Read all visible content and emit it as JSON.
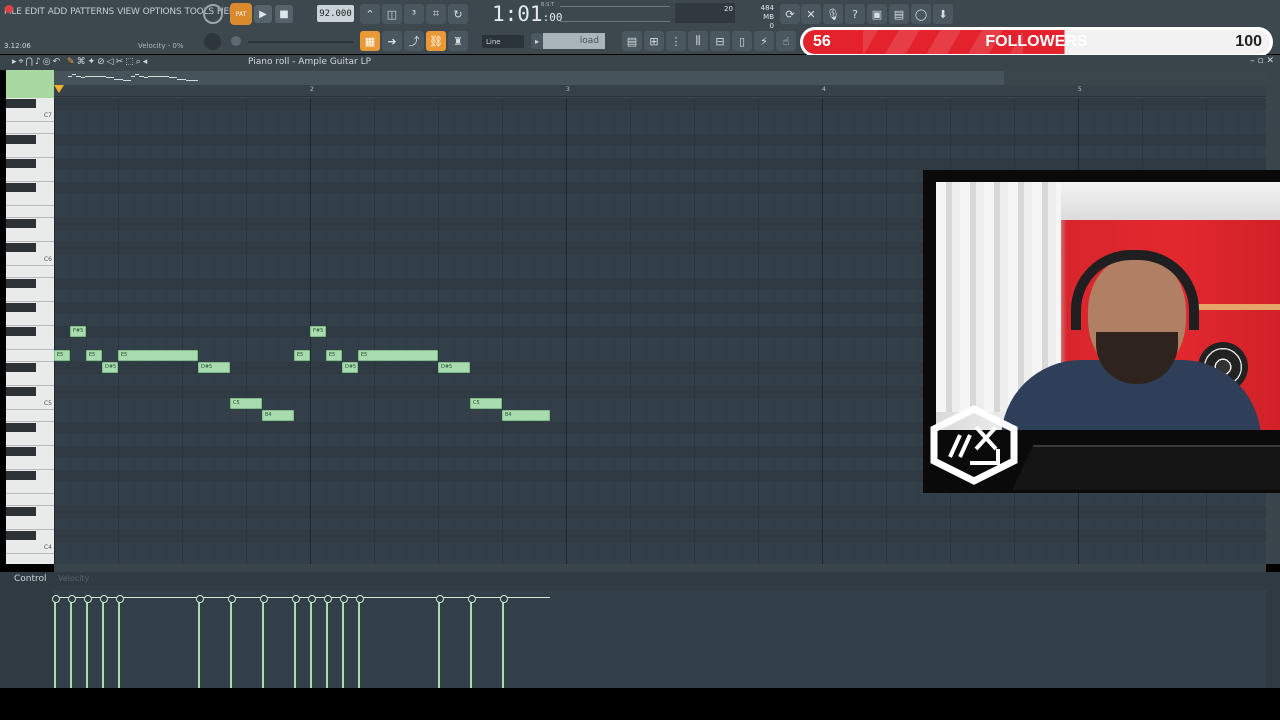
{
  "menu": [
    "FILE",
    "EDIT",
    "ADD",
    "PATTERNS",
    "VIEW",
    "OPTIONS",
    "TOOLS",
    "HELP"
  ],
  "transport": {
    "pattern_label": "PAT",
    "tempo": "92.000",
    "time_main": "1:01",
    "time_small": ":00",
    "time_sub": "B:S:T",
    "cpu_value": "20",
    "ram_value": "484 MB",
    "ram_sub": "0"
  },
  "toolbar2": {
    "position": "3.12:06",
    "velocity": "Velocity - 0%",
    "snap": "Line",
    "load_placeholder": "load"
  },
  "followers": {
    "current": "56",
    "label": "FOLLOWERS",
    "goal": "100",
    "progress": 0.56,
    "bar_color": "#e3222d"
  },
  "piano_roll": {
    "title": "Piano roll - Ample Guitar LP",
    "bar_numbers": [
      "2",
      "3",
      "4",
      "5"
    ],
    "key_labels": [
      "C7",
      "C6",
      "C5",
      "C4"
    ],
    "notes": [
      {
        "label": "E5",
        "start": 0.0,
        "len": 1.0,
        "pitch": "E5"
      },
      {
        "label": "F#5",
        "start": 1.0,
        "len": 1.0,
        "pitch": "F#5"
      },
      {
        "label": "E5",
        "start": 2.0,
        "len": 1.0,
        "pitch": "E5"
      },
      {
        "label": "D#5",
        "start": 3.0,
        "len": 1.0,
        "pitch": "D#5"
      },
      {
        "label": "E5",
        "start": 4.0,
        "len": 5.0,
        "pitch": "E5"
      },
      {
        "label": "D#5",
        "start": 9.0,
        "len": 2.0,
        "pitch": "D#5"
      },
      {
        "label": "C5",
        "start": 11.0,
        "len": 2.0,
        "pitch": "C5"
      },
      {
        "label": "B4",
        "start": 13.0,
        "len": 2.0,
        "pitch": "B4"
      },
      {
        "label": "E5",
        "start": 15.0,
        "len": 1.0,
        "pitch": "E5"
      },
      {
        "label": "F#5",
        "start": 16.0,
        "len": 1.0,
        "pitch": "F#5"
      },
      {
        "label": "E5",
        "start": 17.0,
        "len": 1.0,
        "pitch": "E5"
      },
      {
        "label": "D#5",
        "start": 18.0,
        "len": 1.0,
        "pitch": "D#5"
      },
      {
        "label": "E5",
        "start": 19.0,
        "len": 5.0,
        "pitch": "E5"
      },
      {
        "label": "D#5",
        "start": 24.0,
        "len": 2.0,
        "pitch": "D#5"
      },
      {
        "label": "C5",
        "start": 26.0,
        "len": 2.0,
        "pitch": "C5"
      },
      {
        "label": "B4",
        "start": 28.0,
        "len": 3.0,
        "pitch": "B4"
      }
    ]
  },
  "control": {
    "label": "Control",
    "sub": "Velocity"
  }
}
